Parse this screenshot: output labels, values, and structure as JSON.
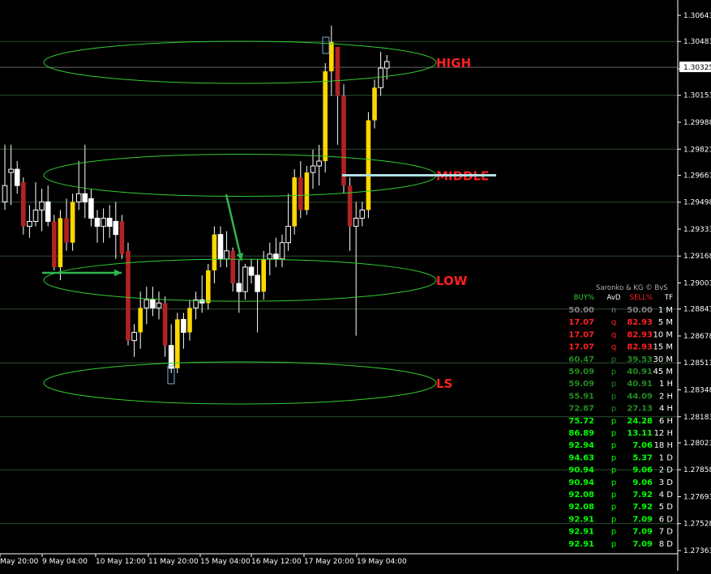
{
  "chart_data": {
    "type": "candlestick",
    "colors": {
      "background": "#000000",
      "bull_body": "#ffd700",
      "bear_body": "#b22222",
      "small_candle": "#ffffff",
      "grid": "#2f4f2f",
      "axis_text": "#ffffff",
      "ellipse": "#32cd32",
      "zone_label": "#ff2020",
      "arrow": "#32b450",
      "middle_line": "#b0e0e6"
    },
    "y_axis": {
      "ylim": [
        1.27363,
        1.30643
      ],
      "tick_labels": [
        "1.30643",
        "1.30483",
        "1.30315",
        "1.30153",
        "1.29988",
        "1.29823",
        "1.29663",
        "1.29498",
        "1.29333",
        "1.29168",
        "1.29003",
        "1.28843",
        "1.28678",
        "1.28513",
        "1.28348",
        "1.28183",
        "1.28023",
        "1.27858",
        "1.27693",
        "1.27528",
        "1.27363"
      ],
      "current_price": "1.30325"
    },
    "x_axis": {
      "tick_labels": [
        "May 20:00",
        "9 May 04:00",
        "10 May 12:00",
        "11 May 20:00",
        "15 May 04:00",
        "16 May 12:00",
        "17 May 20:00",
        "19 May 04:00"
      ]
    },
    "candles": [
      {
        "o": 1.295,
        "h": 1.2985,
        "l": 1.2945,
        "c": 1.296
      },
      {
        "o": 1.2968,
        "h": 1.2985,
        "l": 1.2948,
        "c": 1.297
      },
      {
        "o": 1.297,
        "h": 1.2975,
        "l": 1.2955,
        "c": 1.296
      },
      {
        "o": 1.2962,
        "h": 1.2965,
        "l": 1.293,
        "c": 1.2935
      },
      {
        "o": 1.2935,
        "h": 1.2948,
        "l": 1.2928,
        "c": 1.2938
      },
      {
        "o": 1.2938,
        "h": 1.2962,
        "l": 1.2935,
        "c": 1.2945
      },
      {
        "o": 1.2945,
        "h": 1.2958,
        "l": 1.2932,
        "c": 1.295
      },
      {
        "o": 1.295,
        "h": 1.296,
        "l": 1.2935,
        "c": 1.2938
      },
      {
        "o": 1.2938,
        "h": 1.2942,
        "l": 1.2908,
        "c": 1.291
      },
      {
        "o": 1.291,
        "h": 1.2945,
        "l": 1.2902,
        "c": 1.294
      },
      {
        "o": 1.294,
        "h": 1.2952,
        "l": 1.292,
        "c": 1.2925
      },
      {
        "o": 1.2925,
        "h": 1.2955,
        "l": 1.292,
        "c": 1.295
      },
      {
        "o": 1.295,
        "h": 1.2975,
        "l": 1.2945,
        "c": 1.2955
      },
      {
        "o": 1.2955,
        "h": 1.2985,
        "l": 1.294,
        "c": 1.295
      },
      {
        "o": 1.2952,
        "h": 1.2958,
        "l": 1.2935,
        "c": 1.294
      },
      {
        "o": 1.294,
        "h": 1.2945,
        "l": 1.2925,
        "c": 1.2935
      },
      {
        "o": 1.2935,
        "h": 1.2946,
        "l": 1.2925,
        "c": 1.294
      },
      {
        "o": 1.294,
        "h": 1.2948,
        "l": 1.2928,
        "c": 1.2935
      },
      {
        "o": 1.2938,
        "h": 1.295,
        "l": 1.2915,
        "c": 1.293
      },
      {
        "o": 1.2938,
        "h": 1.2942,
        "l": 1.2915,
        "c": 1.2918
      },
      {
        "o": 1.292,
        "h": 1.2925,
        "l": 1.2862,
        "c": 1.2865
      },
      {
        "o": 1.2865,
        "h": 1.2875,
        "l": 1.2855,
        "c": 1.287
      },
      {
        "o": 1.287,
        "h": 1.2895,
        "l": 1.286,
        "c": 1.2885
      },
      {
        "o": 1.2885,
        "h": 1.2898,
        "l": 1.2875,
        "c": 1.289
      },
      {
        "o": 1.289,
        "h": 1.2898,
        "l": 1.288,
        "c": 1.2885
      },
      {
        "o": 1.2885,
        "h": 1.2895,
        "l": 1.2878,
        "c": 1.2888
      },
      {
        "o": 1.2888,
        "h": 1.2892,
        "l": 1.2855,
        "c": 1.2862
      },
      {
        "o": 1.2862,
        "h": 1.2875,
        "l": 1.2845,
        "c": 1.2848
      },
      {
        "o": 1.2848,
        "h": 1.2882,
        "l": 1.2845,
        "c": 1.2878
      },
      {
        "o": 1.2878,
        "h": 1.2882,
        "l": 1.286,
        "c": 1.287
      },
      {
        "o": 1.287,
        "h": 1.289,
        "l": 1.2865,
        "c": 1.2885
      },
      {
        "o": 1.2885,
        "h": 1.2895,
        "l": 1.2878,
        "c": 1.289
      },
      {
        "o": 1.289,
        "h": 1.2905,
        "l": 1.2882,
        "c": 1.2888
      },
      {
        "o": 1.2888,
        "h": 1.2912,
        "l": 1.2884,
        "c": 1.2908
      },
      {
        "o": 1.2908,
        "h": 1.2935,
        "l": 1.29,
        "c": 1.293
      },
      {
        "o": 1.293,
        "h": 1.2935,
        "l": 1.291,
        "c": 1.2915
      },
      {
        "o": 1.2915,
        "h": 1.2932,
        "l": 1.291,
        "c": 1.292
      },
      {
        "o": 1.292,
        "h": 1.2922,
        "l": 1.2895,
        "c": 1.29
      },
      {
        "o": 1.29,
        "h": 1.2915,
        "l": 1.2882,
        "c": 1.2895
      },
      {
        "o": 1.2895,
        "h": 1.2912,
        "l": 1.289,
        "c": 1.291
      },
      {
        "o": 1.291,
        "h": 1.2915,
        "l": 1.29,
        "c": 1.2905
      },
      {
        "o": 1.2905,
        "h": 1.2915,
        "l": 1.287,
        "c": 1.2895
      },
      {
        "o": 1.2895,
        "h": 1.292,
        "l": 1.289,
        "c": 1.2915
      },
      {
        "o": 1.2915,
        "h": 1.2925,
        "l": 1.2905,
        "c": 1.2918
      },
      {
        "o": 1.2918,
        "h": 1.2928,
        "l": 1.291,
        "c": 1.2915
      },
      {
        "o": 1.2915,
        "h": 1.293,
        "l": 1.291,
        "c": 1.2925
      },
      {
        "o": 1.2925,
        "h": 1.2955,
        "l": 1.292,
        "c": 1.2935
      },
      {
        "o": 1.2935,
        "h": 1.297,
        "l": 1.293,
        "c": 1.2965
      },
      {
        "o": 1.2965,
        "h": 1.2975,
        "l": 1.294,
        "c": 1.2945
      },
      {
        "o": 1.2945,
        "h": 1.2972,
        "l": 1.2942,
        "c": 1.2968
      },
      {
        "o": 1.2968,
        "h": 1.2982,
        "l": 1.2958,
        "c": 1.2972
      },
      {
        "o": 1.2972,
        "h": 1.2985,
        "l": 1.296,
        "c": 1.2975
      },
      {
        "o": 1.2975,
        "h": 1.3035,
        "l": 1.2968,
        "c": 1.303
      },
      {
        "o": 1.303,
        "h": 1.3058,
        "l": 1.3015,
        "c": 1.3048
      },
      {
        "o": 1.3045,
        "h": 1.3045,
        "l": 1.2985,
        "c": 1.3015
      },
      {
        "o": 1.3015,
        "h": 1.3022,
        "l": 1.2955,
        "c": 1.296
      },
      {
        "o": 1.296,
        "h": 1.2965,
        "l": 1.292,
        "c": 1.2935
      },
      {
        "o": 1.2935,
        "h": 1.295,
        "l": 1.2868,
        "c": 1.294
      },
      {
        "o": 1.294,
        "h": 1.295,
        "l": 1.2935,
        "c": 1.2945
      },
      {
        "o": 1.2945,
        "h": 1.3005,
        "l": 1.294,
        "c": 1.3
      },
      {
        "o": 1.3,
        "h": 1.3025,
        "l": 1.2995,
        "c": 1.302
      },
      {
        "o": 1.302,
        "h": 1.3042,
        "l": 1.3015,
        "c": 1.3032
      },
      {
        "o": 1.3032,
        "h": 1.304,
        "l": 1.3025,
        "c": 1.3036
      }
    ],
    "zones": [
      {
        "label": "HIGH",
        "center": 1.30355
      },
      {
        "label": "MIDDLE",
        "center": 1.29663
      },
      {
        "label": "LOW",
        "center": 1.2902
      },
      {
        "label": "LS",
        "center": 1.2839
      }
    ],
    "middle_line_level": 1.29663
  },
  "panel": {
    "title": "Saronko & KG © BvS",
    "headers": [
      "BUY%",
      "AvD",
      "SELL%",
      "TF"
    ],
    "header_colors": [
      "#32cd32",
      "#ffffff",
      "#ff2020",
      "#ffffff"
    ],
    "rows": [
      {
        "buy": "50.00",
        "avd": "n",
        "sell": "50.00",
        "tf": "1 M",
        "color": "#808080"
      },
      {
        "buy": "17.07",
        "avd": "q",
        "sell": "82.93",
        "tf": "5 M",
        "color": "#ff2020"
      },
      {
        "buy": "17.07",
        "avd": "q",
        "sell": "82.93",
        "tf": "10 M",
        "color": "#ff2020"
      },
      {
        "buy": "17.07",
        "avd": "q",
        "sell": "82.93",
        "tf": "15 M",
        "color": "#ff2020"
      },
      {
        "buy": "60.47",
        "avd": "p",
        "sell": "39.53",
        "tf": "30 M",
        "color": "#228b22"
      },
      {
        "buy": "59.09",
        "avd": "p",
        "sell": "40.91",
        "tf": "45 M",
        "color": "#228b22"
      },
      {
        "buy": "59.09",
        "avd": "p",
        "sell": "40.91",
        "tf": "1 H",
        "color": "#228b22"
      },
      {
        "buy": "55.91",
        "avd": "p",
        "sell": "44.09",
        "tf": "2 H",
        "color": "#228b22"
      },
      {
        "buy": "72.87",
        "avd": "p",
        "sell": "27.13",
        "tf": "4 H",
        "color": "#228b22"
      },
      {
        "buy": "75.72",
        "avd": "p",
        "sell": "24.28",
        "tf": "6 H",
        "color": "#00ff00"
      },
      {
        "buy": "86.89",
        "avd": "p",
        "sell": "13.11",
        "tf": "12 H",
        "color": "#00ff00"
      },
      {
        "buy": "92.94",
        "avd": "p",
        "sell": "7.06",
        "tf": "18 H",
        "color": "#00ff00"
      },
      {
        "buy": "94.63",
        "avd": "p",
        "sell": "5.37",
        "tf": "1 D",
        "color": "#00ff00"
      },
      {
        "buy": "90.94",
        "avd": "p",
        "sell": "9.06",
        "tf": "2 D",
        "color": "#00ff00"
      },
      {
        "buy": "90.94",
        "avd": "p",
        "sell": "9.06",
        "tf": "3 D",
        "color": "#00ff00"
      },
      {
        "buy": "92.08",
        "avd": "p",
        "sell": "7.92",
        "tf": "4 D",
        "color": "#00ff00"
      },
      {
        "buy": "92.08",
        "avd": "p",
        "sell": "7.92",
        "tf": "5 D",
        "color": "#00ff00"
      },
      {
        "buy": "92.91",
        "avd": "p",
        "sell": "7.09",
        "tf": "6 D",
        "color": "#00ff00"
      },
      {
        "buy": "92.91",
        "avd": "p",
        "sell": "7.09",
        "tf": "7 D",
        "color": "#00ff00"
      },
      {
        "buy": "92.91",
        "avd": "p",
        "sell": "7.09",
        "tf": "8 D",
        "color": "#00ff00"
      }
    ]
  }
}
